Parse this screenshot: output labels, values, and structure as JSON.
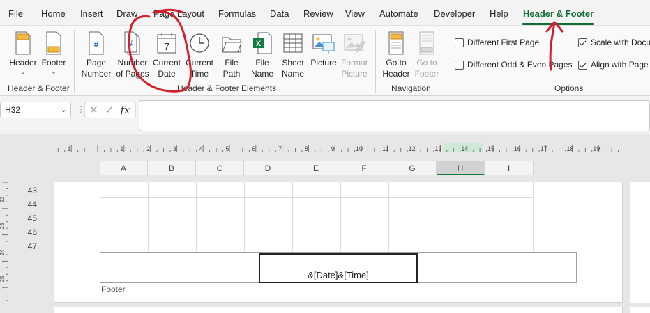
{
  "menu": {
    "tabs": [
      "File",
      "Home",
      "Insert",
      "Draw",
      "Page Layout",
      "Formulas",
      "Data",
      "Review",
      "View",
      "Automate",
      "Developer",
      "Help",
      "Header & Footer"
    ]
  },
  "ribbon": {
    "header_btn": "Header",
    "footer_btn": "Footer",
    "group_hf": "Header & Footer",
    "page_number_1": "Page",
    "page_number_2": "Number",
    "number_of_pages_1": "Number",
    "number_of_pages_2": "of Pages",
    "current_date_1": "Current",
    "current_date_2": "Date",
    "current_time_1": "Current",
    "current_time_2": "Time",
    "file_path_1": "File",
    "file_path_2": "Path",
    "file_name_1": "File",
    "file_name_2": "Name",
    "sheet_name_1": "Sheet",
    "sheet_name_2": "Name",
    "picture": "Picture",
    "format_picture_1": "Format",
    "format_picture_2": "Picture",
    "group_elements": "Header & Footer Elements",
    "goto_header_1": "Go to",
    "goto_header_2": "Header",
    "goto_footer_1": "Go to",
    "goto_footer_2": "Footer",
    "group_navigation": "Navigation",
    "diff_first_page": "Different First Page",
    "diff_odd_even": "Different Odd & Even Pages",
    "scale_with_doc": "Scale with Docu",
    "align_with_page": "Align with Page",
    "group_options": "Options",
    "date_icon_day": "7"
  },
  "formula_bar": {
    "name_box": "H32",
    "cancel": "✕",
    "enter": "✓",
    "fx": "fx"
  },
  "columns": [
    "A",
    "B",
    "C",
    "D",
    "E",
    "F",
    "G",
    "H",
    "I"
  ],
  "selected_column": "H",
  "rows": [
    "43",
    "44",
    "45",
    "46",
    "47"
  ],
  "ruler_top_labels": [
    "1",
    "1",
    "2",
    "3",
    "4",
    "5",
    "6",
    "7",
    "8",
    "9",
    "10",
    "11",
    "12",
    "13",
    "14",
    "15",
    "16",
    "17",
    "18",
    "19"
  ],
  "ruler_left_labels": [
    "22",
    "23",
    "24",
    "25"
  ],
  "footer": {
    "center_text": "&[Date]&[Time]",
    "label": "Footer"
  },
  "colors": {
    "accent": "#0e6b32",
    "annotation": "#d21f2a"
  }
}
